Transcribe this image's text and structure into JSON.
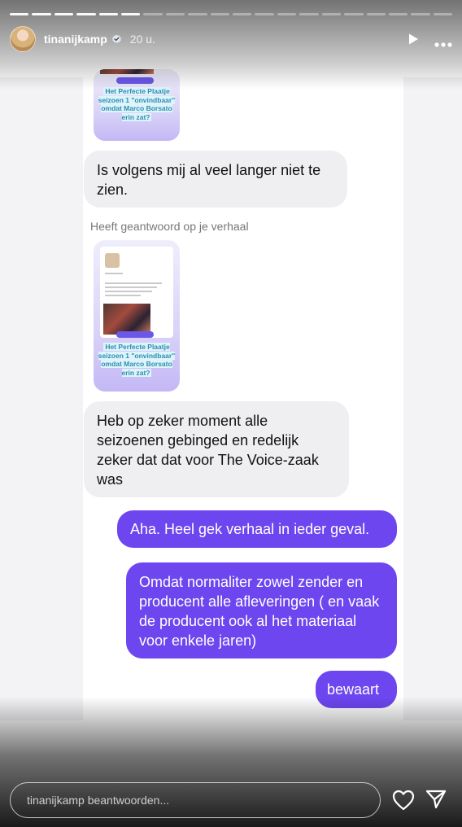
{
  "header": {
    "username": "tinanijkamp",
    "time": "20 u."
  },
  "progress": {
    "total_segments": 20,
    "completed_segments": 6
  },
  "chat": {
    "thumb1_caption": "Het Perfecte Plaatje seizoen 1 \"onvindbaar\" omdat Marco Borsato erin zat?",
    "message1": "Is volgens mij al veel langer niet te zien.",
    "reply_note": "Heeft geantwoord op je verhaal",
    "thumb2_caption": "Het Perfecte Plaatje seizoen 1 \"onvindbaar\" omdat Marco Borsato erin zat?",
    "message2": "Heb op zeker moment alle seizoenen gebinged en redelijk zeker dat dat voor The Voice-zaak was",
    "message3": "Aha. Heel gek verhaal in ieder geval.",
    "message4": "Omdat normaliter zowel zender en producent alle afleveringen ( en vaak de producent ook al het materiaal voor enkele jaren)",
    "message5": "bewaart"
  },
  "footer": {
    "reply_placeholder": "tinanijkamp beantwoorden..."
  },
  "colors": {
    "outgoing_bubble": "#6d46f0",
    "incoming_bubble": "#efeff2"
  }
}
